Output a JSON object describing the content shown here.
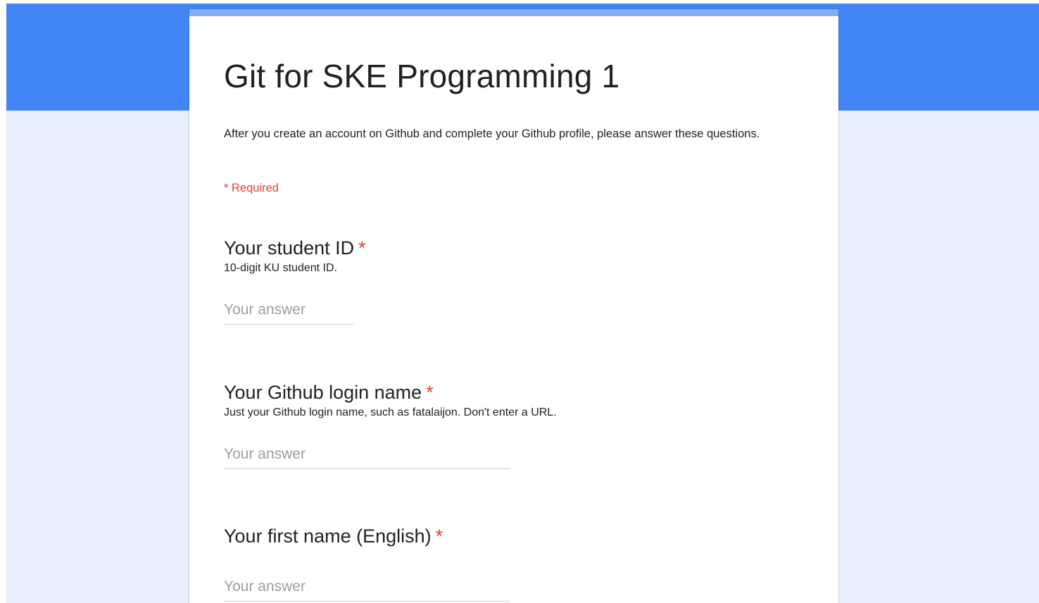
{
  "form": {
    "title": "Git for SKE Programming 1",
    "description": "After you create an account on Github and complete your Github profile, please answer these questions.",
    "required_note": "* Required"
  },
  "questions": [
    {
      "title": "Your student ID",
      "required_mark": "*",
      "help": "10-digit KU student ID.",
      "placeholder": "Your answer"
    },
    {
      "title": "Your Github login name",
      "required_mark": "*",
      "help": "Just your Github login name, such as fatalaijon. Don't enter a URL.",
      "placeholder": "Your answer"
    },
    {
      "title": "Your first name (English)",
      "required_mark": "*",
      "placeholder": "Your answer"
    }
  ],
  "colors": {
    "header": "#4285f4",
    "accent": "#82aff9",
    "background": "#e8eefb",
    "required": "#db4437"
  }
}
